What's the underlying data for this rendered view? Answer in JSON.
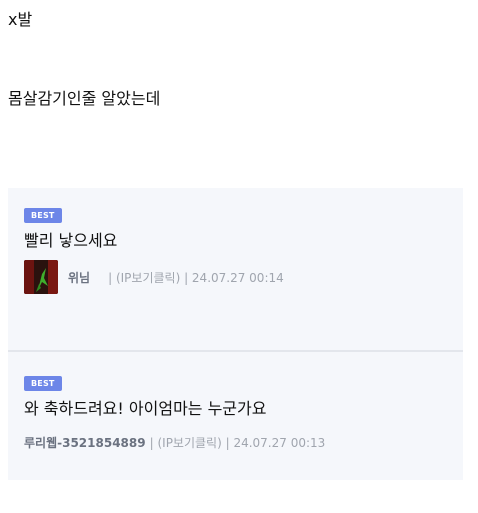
{
  "post": {
    "line1": "x발",
    "line2": "몸살감기인줄 알았는데"
  },
  "comments": [
    {
      "badge": "BEST",
      "text": "빨리 낳으세요",
      "author": "위님",
      "meta": "| (IP보기클릭) | 24.07.27 00:14"
    },
    {
      "badge": "BEST",
      "text": "와 축하드려요! 아이엄마는 누군가요",
      "author": "루리웹-3521854889",
      "meta": "| (IP보기클릭) | 24.07.27 00:13"
    }
  ],
  "colors": {
    "badge": "#6d86e8",
    "panel": "#f5f7fb",
    "divider": "#e3e6ec",
    "meta": "#9aa0aa"
  },
  "icons": {
    "avatar": "user-avatar-image"
  }
}
